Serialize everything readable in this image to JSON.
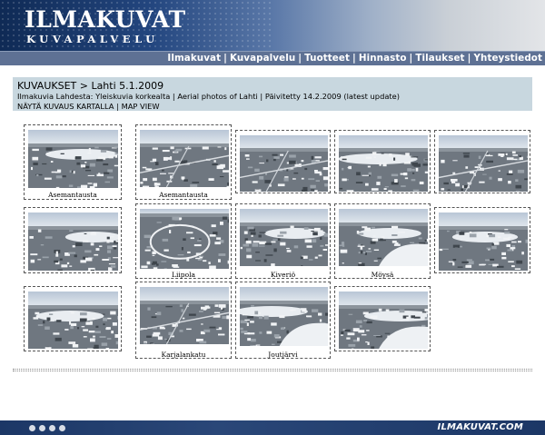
{
  "header": {
    "logo_main": "ILMAKUVAT",
    "logo_sub": "KUVAPALVELU"
  },
  "nav": {
    "items": [
      "Ilmakuvat",
      "Kuvapalvelu",
      "Tuotteet",
      "Hinnasto",
      "Tilaukset",
      "Yhteystiedot"
    ],
    "separator": "|"
  },
  "info": {
    "title": "KUVAUKSET > Lahti 5.1.2009",
    "description": "Ilmakuvia Lahdesta: Yleiskuvia korkealta | Aerial photos of Lahti | Päivitetty 14.2.2009 (latest update)",
    "map_link": "NÄYTÄ KUVAUS KARTALLA",
    "map_sep": "|",
    "map_link_en": "MAP VIEW"
  },
  "gallery": {
    "thumbnails": [
      {
        "caption": "Asemantausta",
        "scene": "lake"
      },
      {
        "caption": "Asemantausta",
        "scene": "city"
      },
      {
        "caption": "",
        "scene": "city"
      },
      {
        "caption": "",
        "scene": "lake"
      },
      {
        "caption": "",
        "scene": "city"
      },
      {
        "caption": "",
        "scene": "lake"
      },
      {
        "caption": "Liipola",
        "scene": "ring"
      },
      {
        "caption": "Kiveriö",
        "scene": "lake"
      },
      {
        "caption": "Möysä",
        "scene": "coast"
      },
      {
        "caption": "",
        "scene": "lake"
      },
      {
        "caption": "",
        "scene": "lake"
      },
      {
        "caption": "Karjalankatu",
        "scene": "city"
      },
      {
        "caption": "Joutjärvi",
        "scene": "coast"
      },
      {
        "caption": "",
        "scene": "coast"
      }
    ]
  },
  "footer": {
    "brand": "ILMAKUVAT.COM"
  },
  "colors": {
    "infobox_bg": "#c8d7df",
    "navbar_bg": "#5e7194",
    "footer_bg": "#1c3766"
  }
}
